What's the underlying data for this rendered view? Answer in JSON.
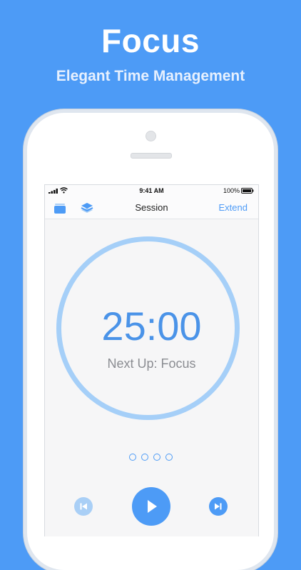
{
  "headline": "Focus",
  "subheadline": "Elegant Time Management",
  "status_bar": {
    "time": "9:41 AM",
    "battery": "100%"
  },
  "nav": {
    "title": "Session",
    "extend_label": "Extend",
    "left_icons": [
      "stack-icon",
      "layers-icon"
    ]
  },
  "timer": {
    "time": "25:00",
    "next_up": "Next Up: Focus"
  },
  "page_indicator": {
    "count": 4,
    "current": 0
  },
  "controls": {
    "previous": "skip-back-icon",
    "play": "play-icon",
    "next": "skip-forward-icon"
  },
  "colors": {
    "background": "#4d9bf6",
    "accent": "#4d9bf6",
    "ring": "#a5cff8",
    "timer_text": "#4a93e8"
  }
}
